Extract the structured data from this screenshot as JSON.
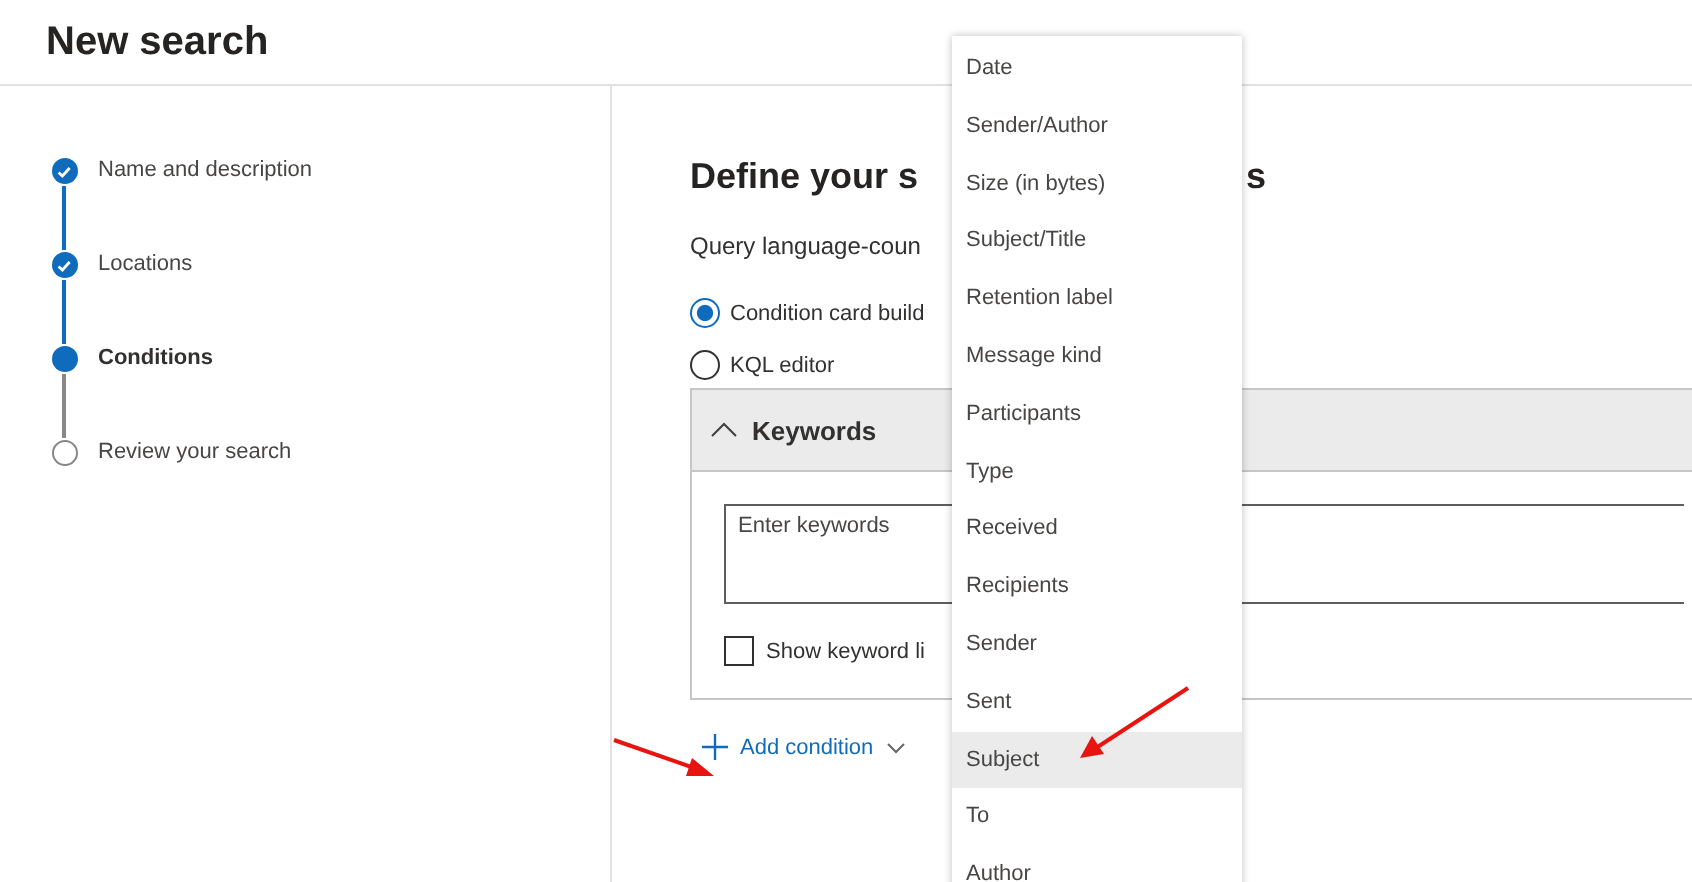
{
  "page": {
    "title": "New search"
  },
  "steps": [
    {
      "label": "Name and description",
      "done": true,
      "current": false
    },
    {
      "label": "Locations",
      "done": true,
      "current": false
    },
    {
      "label": "Conditions",
      "done": false,
      "current": true
    },
    {
      "label": "Review your search",
      "done": false,
      "current": false
    }
  ],
  "main": {
    "heading_parts": [
      "Define your s",
      "s"
    ],
    "query_label": "Query language-coun",
    "modes": [
      {
        "label": "Condition card build",
        "selected": true
      },
      {
        "label": "KQL editor",
        "selected": false
      }
    ],
    "card": {
      "title": "Keywords",
      "expanded": true,
      "placeholder": "Enter keywords",
      "checkbox": {
        "label": "Show keyword li",
        "checked": false
      }
    },
    "add_condition": "Add condition"
  },
  "dropdown": [
    {
      "label": "Date",
      "selected": false
    },
    {
      "label": "Sender/Author",
      "selected": false
    },
    {
      "label": "Size (in bytes)",
      "selected": false
    },
    {
      "label": "Subject/Title",
      "selected": false
    },
    {
      "label": "Retention label",
      "selected": false
    },
    {
      "label": "Message kind",
      "selected": false
    },
    {
      "label": "Participants",
      "selected": false
    },
    {
      "label": "Type",
      "selected": false
    },
    {
      "label": "Received",
      "selected": false
    },
    {
      "label": "Recipients",
      "selected": false
    },
    {
      "label": "Sender",
      "selected": false
    },
    {
      "label": "Sent",
      "selected": false
    },
    {
      "label": "Subject",
      "selected": true
    },
    {
      "label": "To",
      "selected": false
    },
    {
      "label": "Author",
      "selected": false
    }
  ]
}
